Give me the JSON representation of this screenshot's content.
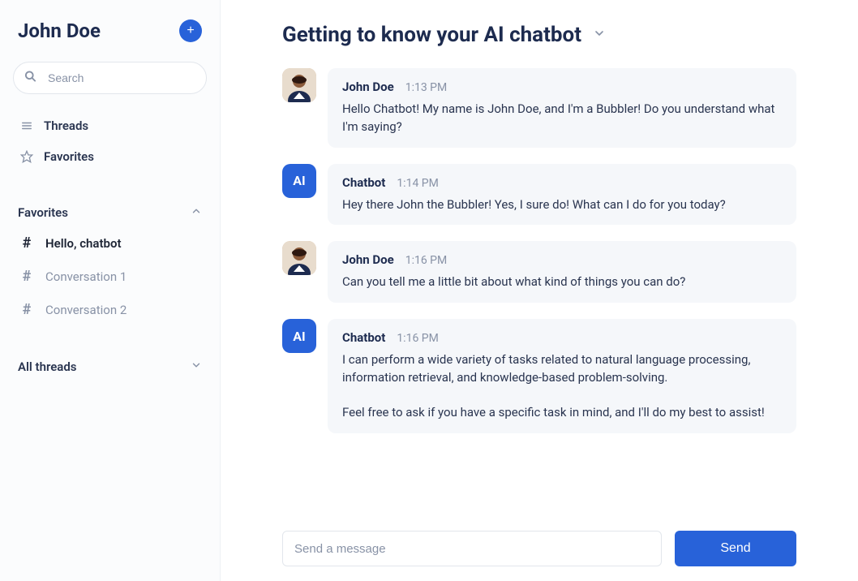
{
  "sidebar": {
    "title": "John Doe",
    "search_placeholder": "Search",
    "nav": {
      "threads": "Threads",
      "favorites": "Favorites"
    },
    "sections": {
      "favorites": {
        "title": "Favorites",
        "items": [
          {
            "label": "Hello, chatbot",
            "active": true
          },
          {
            "label": "Conversation 1",
            "active": false
          },
          {
            "label": "Conversation 2",
            "active": false
          }
        ]
      },
      "all_threads": {
        "title": "All threads"
      }
    }
  },
  "chat": {
    "title": "Getting to know your AI chatbot",
    "messages": [
      {
        "sender": "user",
        "name": "John Doe",
        "time": "1:13 PM",
        "body": "Hello Chatbot! My name is John Doe, and I'm a Bubbler! Do you understand what I'm saying?"
      },
      {
        "sender": "ai",
        "name": "Chatbot",
        "avatar_label": "AI",
        "time": "1:14 PM",
        "body": "Hey there John the Bubbler! Yes, I sure do! What can I do for you today?"
      },
      {
        "sender": "user",
        "name": "John Doe",
        "time": "1:16 PM",
        "body": "Can you tell me a little bit about what kind of things you can do?"
      },
      {
        "sender": "ai",
        "name": "Chatbot",
        "avatar_label": "AI",
        "time": "1:16 PM",
        "body": "I can perform a wide variety of tasks related to natural language processing, information retrieval, and knowledge-based problem-solving.\n\nFeel free to ask if you have a specific task in mind, and I'll do my best to assist!"
      }
    ],
    "composer": {
      "placeholder": "Send a message",
      "send_label": "Send"
    }
  }
}
